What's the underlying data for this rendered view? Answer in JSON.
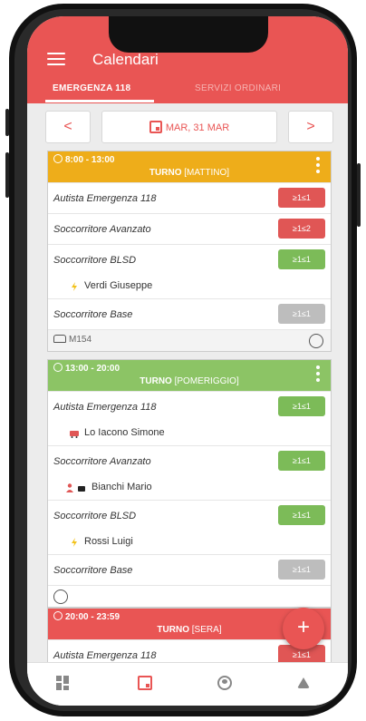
{
  "app": {
    "title": "Calendari"
  },
  "tabs": [
    {
      "label": "EMERGENZA 118",
      "active": true
    },
    {
      "label": "SERVIZI ORDINARI",
      "active": false
    }
  ],
  "datebar": {
    "prev": "<",
    "date": "MAR, 31 MAR",
    "next": ">"
  },
  "colors": {
    "accent": "#e95554",
    "morning": "#eead1a",
    "afternoon": "#8cc465",
    "badge_red": "#e05655",
    "badge_green": "#7cbb58",
    "badge_gray": "#bdbdbd"
  },
  "shifts": [
    {
      "time": "8:00 - 13:00",
      "turno": "TURNO",
      "period": "[MATTINO]",
      "roles": [
        {
          "name": "Autista Emergenza 118",
          "badge": "≥1≤1",
          "status": "red"
        },
        {
          "name": "Soccorritore Avanzato",
          "badge": "≥1≤2",
          "status": "red"
        },
        {
          "name": "Soccorritore BLSD",
          "badge": "≥1≤1",
          "status": "green",
          "person": "Verdi Giuseppe"
        },
        {
          "name": "Soccorritore Base",
          "badge": "≥1≤1",
          "status": "gray"
        }
      ],
      "vehicle": "M154"
    },
    {
      "time": "13:00 - 20:00",
      "turno": "TURNO",
      "period": "[POMERIGGIO]",
      "roles": [
        {
          "name": "Autista Emergenza 118",
          "badge": "≥1≤1",
          "status": "green",
          "person": "Lo Iacono Simone"
        },
        {
          "name": "Soccorritore Avanzato",
          "badge": "≥1≤1",
          "status": "green",
          "person": "Bianchi Mario"
        },
        {
          "name": "Soccorritore BLSD",
          "badge": "≥1≤1",
          "status": "green",
          "person": "Rossi Luigi"
        },
        {
          "name": "Soccorritore Base",
          "badge": "≥1≤1",
          "status": "gray"
        }
      ]
    },
    {
      "time": "20:00 - 23:59",
      "turno": "TURNO",
      "period": "[SERA]",
      "roles": [
        {
          "name": "Autista Emergenza 118",
          "badge": "≥1≤1",
          "status": "red"
        }
      ]
    }
  ],
  "fab": {
    "label": "+"
  },
  "bottom_nav": [
    {
      "icon": "dashboard-icon"
    },
    {
      "icon": "calendar-icon",
      "active": true
    },
    {
      "icon": "account-icon"
    },
    {
      "icon": "bell-icon"
    }
  ]
}
